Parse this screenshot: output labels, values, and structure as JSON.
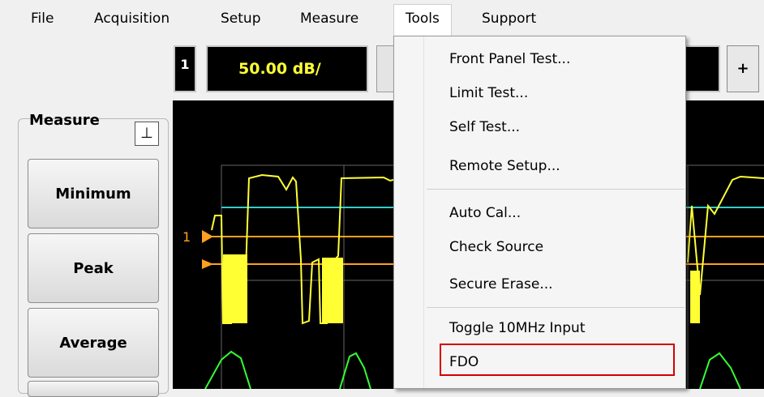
{
  "menu": {
    "file": "File",
    "acquisition": "Acquisition",
    "setup": "Setup",
    "measure": "Measure",
    "tools": "Tools",
    "support": "Support"
  },
  "toolbar": {
    "channel": "1",
    "scale": "50.00 dB/",
    "plus": "+"
  },
  "measure_panel": {
    "title": "Measure",
    "pin_icon": "pin-icon",
    "buttons": [
      "Minimum",
      "Peak",
      "Average"
    ]
  },
  "display": {
    "marker_label": "1",
    "colors": {
      "background": "#000000",
      "trace_yellow": "#ffff33",
      "trace_green": "#33ff33",
      "cyan_line": "#33cccc",
      "orange_marker": "#ffa020",
      "grid": "#666666"
    }
  },
  "tools_menu": {
    "items": [
      "Front Panel Test...",
      "Limit Test...",
      "Self Test...",
      "Remote Setup...",
      "Auto Cal...",
      "Check Source",
      "Secure Erase...",
      "Toggle 10MHz Input",
      "FDO"
    ],
    "highlighted": "FDO",
    "highlight_color": "#d40000"
  }
}
